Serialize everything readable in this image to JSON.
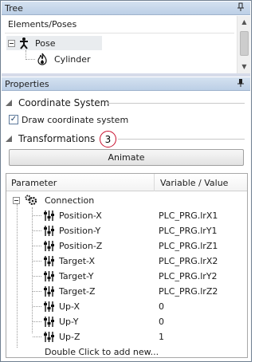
{
  "tree_panel": {
    "title": "Tree",
    "pin_icon": "pin-icon",
    "column_header": "Elements/Poses",
    "items": [
      {
        "label": "Pose",
        "icon": "pose-figure-icon",
        "selected": true
      },
      {
        "label": "Cylinder",
        "icon": "flame-icon"
      }
    ]
  },
  "properties_panel": {
    "title": "Properties",
    "pin_icon": "pin-icon",
    "coordinate_system": {
      "title": "Coordinate System",
      "checkbox_label": "Draw coordinate system",
      "checked": true
    },
    "transformations": {
      "title": "Transformations",
      "badge": "3",
      "badge_color": "#c8102e",
      "animate_label": "Animate"
    },
    "grid": {
      "col_parameter": "Parameter",
      "col_value": "Variable / Value",
      "group": {
        "label": "Connection",
        "icon": "gears-icon"
      },
      "rows": [
        {
          "name": "Position-X",
          "value": "PLC_PRG.lrX1"
        },
        {
          "name": "Position-Y",
          "value": "PLC_PRG.lrY1"
        },
        {
          "name": "Position-Z",
          "value": "PLC_PRG.lrZ1"
        },
        {
          "name": "Target-X",
          "value": "PLC_PRG.lrX2"
        },
        {
          "name": "Target-Y",
          "value": "PLC_PRG.lrY2"
        },
        {
          "name": "Target-Z",
          "value": "PLC_PRG.lrZ2"
        },
        {
          "name": "Up-X",
          "value": "0"
        },
        {
          "name": "Up-Y",
          "value": "0"
        },
        {
          "name": "Up-Z",
          "value": "1"
        }
      ],
      "add_hint": "Double Click to add new..."
    }
  }
}
